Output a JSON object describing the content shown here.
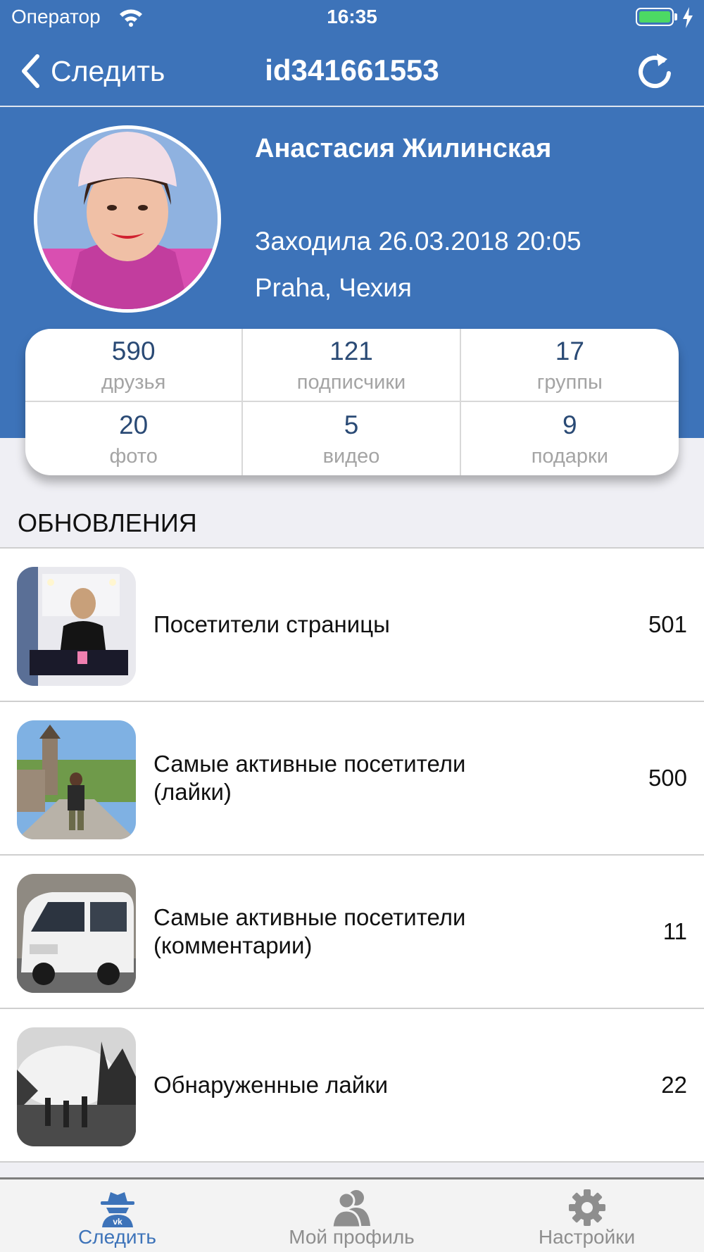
{
  "status_bar": {
    "carrier": "Оператор",
    "time": "16:35",
    "battery_color": "#4cd964"
  },
  "nav": {
    "back_label": "Следить",
    "title": "id341661553",
    "back_icon": "chevron-left-icon",
    "action_icon": "refresh-icon"
  },
  "profile": {
    "name": "Анастасия Жилинская",
    "last_seen": "Заходила 26.03.2018 20:05",
    "location": "Praha, Чехия"
  },
  "stats": [
    {
      "value": "590",
      "label": "друзья"
    },
    {
      "value": "121",
      "label": "подписчики"
    },
    {
      "value": "17",
      "label": "группы"
    },
    {
      "value": "20",
      "label": "фото"
    },
    {
      "value": "5",
      "label": "видео"
    },
    {
      "value": "9",
      "label": "подарки"
    }
  ],
  "updates": {
    "title": "ОБНОВЛЕНИЯ",
    "items": [
      {
        "label": "Посетители страницы",
        "count": "501"
      },
      {
        "label": "Самые активные посетители (лайки)",
        "count": "500"
      },
      {
        "label": "Самые активные посетители (комментарии)",
        "count": "11"
      },
      {
        "label": "Обнаруженные лайки",
        "count": "22"
      }
    ]
  },
  "tab_bar": {
    "tabs": [
      {
        "label": "Следить",
        "icon": "spy-icon",
        "active": true
      },
      {
        "label": "Мой профиль",
        "icon": "users-icon",
        "active": false
      },
      {
        "label": "Настройки",
        "icon": "gear-icon",
        "active": false
      }
    ]
  },
  "colors": {
    "brand_blue": "#3d73b9",
    "stat_value": "#2a4a75",
    "stat_label": "#a4a4a4",
    "background": "#efeff4"
  }
}
